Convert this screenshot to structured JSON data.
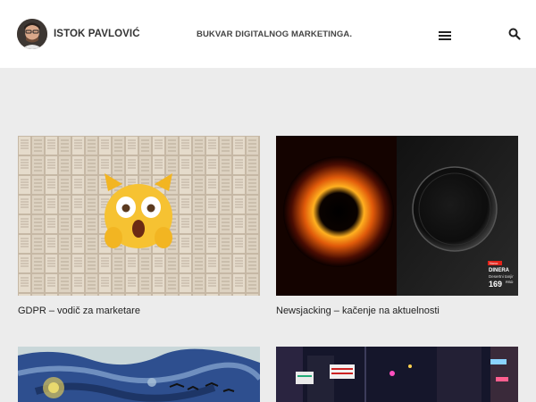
{
  "site": {
    "author_name": "ISTOK PAVLOVIĆ",
    "tagline": "BUKVAR DIGITALNOG MARKETINGA."
  },
  "header": {
    "avatar_icon": "avatar-photo",
    "menu_icon": "hamburger-menu-icon",
    "search_icon": "search-icon"
  },
  "posts": [
    {
      "title": "GDPR – vodič za marketare",
      "image": "open-books-with-screaming-cat-emoji"
    },
    {
      "title": "Newsjacking – kačenje na aktuelnosti",
      "image": "black-hole-chocolate-ad",
      "ad": {
        "brand": "DINERA",
        "sub": "Desertni tanjir",
        "price": "169",
        "currency": "RSD",
        "tag": "Novo"
      }
    },
    {
      "title": "",
      "image": "starry-night-painting"
    },
    {
      "title": "",
      "image": "neon-city-street-night"
    }
  ],
  "colors": {
    "page_bg": "#ececec",
    "header_bg": "#ffffff",
    "text": "#222222"
  }
}
